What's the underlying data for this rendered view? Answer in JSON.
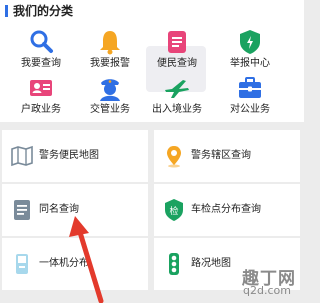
{
  "section": {
    "title": "我们的分类",
    "accent_color": "#2f6fe4"
  },
  "categories": [
    {
      "label": "我要查询",
      "icon": "search-icon"
    },
    {
      "label": "我要报警",
      "icon": "bell-icon"
    },
    {
      "label": "便民查询",
      "icon": "document-icon",
      "selected": true
    },
    {
      "label": "举报中心",
      "icon": "shield-icon"
    },
    {
      "label": "户政业务",
      "icon": "id-card-icon"
    },
    {
      "label": "交管业务",
      "icon": "police-officer-icon"
    },
    {
      "label": "出入境业务",
      "icon": "airplane-icon"
    },
    {
      "label": "对公业务",
      "icon": "briefcase-icon"
    }
  ],
  "services": [
    {
      "label": "警务便民地图",
      "icon": "map-icon"
    },
    {
      "label": "警务辖区查询",
      "icon": "location-pin-icon"
    },
    {
      "label": "同名查询",
      "icon": "file-list-icon"
    },
    {
      "label": "车检点分布查询",
      "icon": "inspection-shield-icon"
    },
    {
      "label": "一体机分布",
      "icon": "kiosk-icon"
    },
    {
      "label": "路况地图",
      "icon": "traffic-light-icon"
    }
  ],
  "watermark": {
    "line1": "趣丁网",
    "line2": "q2d.com"
  },
  "colors": {
    "blue": "#2f6fe4",
    "orange": "#f5a623",
    "pink": "#e8457a",
    "green": "#1aa260",
    "arrow_red": "#e33a2c"
  }
}
